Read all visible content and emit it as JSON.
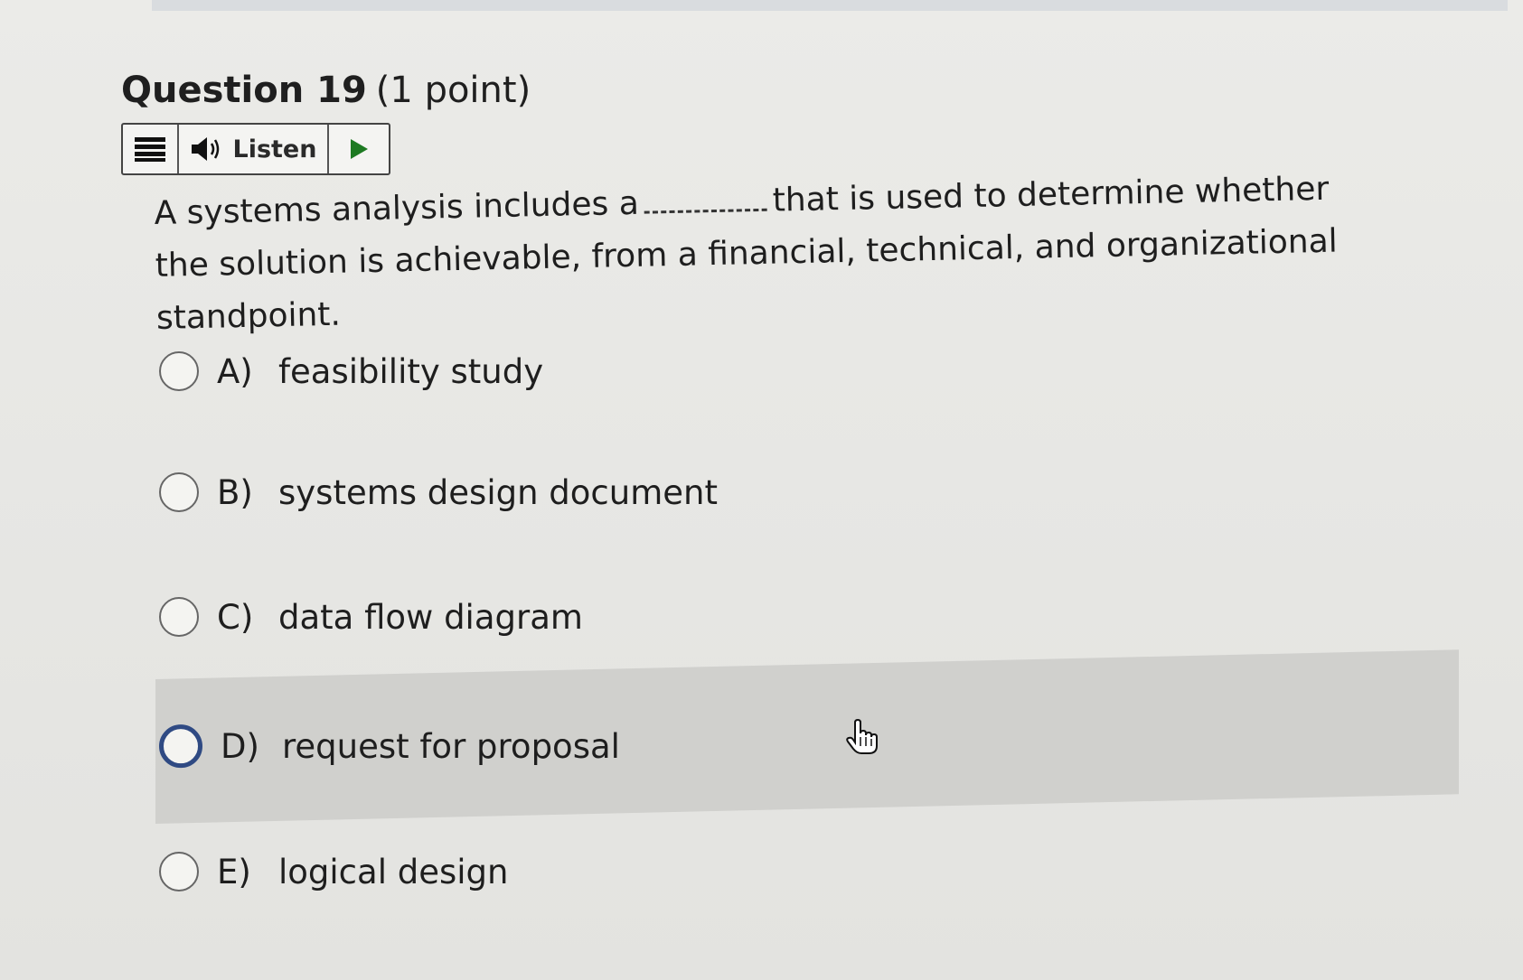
{
  "question": {
    "title": "Question 19",
    "points": "(1 point)",
    "text_before": "A systems analysis includes a",
    "text_after": "that is used to determine whether the solution is achievable, from a financial, technical, and organizational standpoint."
  },
  "listen_toolbar": {
    "menu_icon": "menu-icon",
    "speaker_icon": "speaker-icon",
    "listen_label": "Listen",
    "play_icon": "play-icon"
  },
  "options": [
    {
      "letter": "A)",
      "text": "feasibility study"
    },
    {
      "letter": "B)",
      "text": "systems design document"
    },
    {
      "letter": "C)",
      "text": "data flow diagram"
    },
    {
      "letter": "D)",
      "text": "request for proposal"
    },
    {
      "letter": "E)",
      "text": "logical design"
    }
  ],
  "colors": {
    "focus_ring": "#2f4a83",
    "hover_background": "#d0d0cd"
  }
}
